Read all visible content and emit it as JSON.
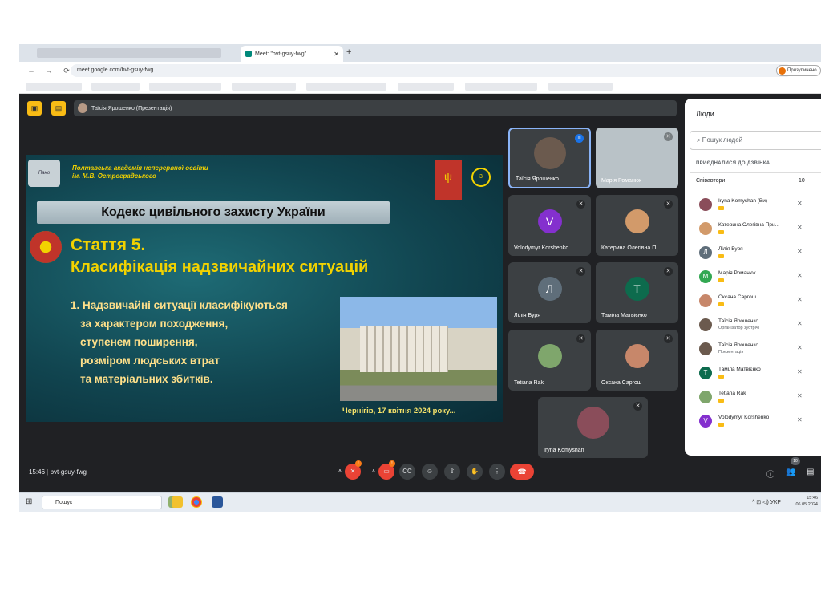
{
  "browser": {
    "tab_title": "Meet: \"bvt-gsuy-fwg\"",
    "tab_close": "✕",
    "new_tab": "+",
    "url": "meet.google.com/bvt-gsuy-fwg",
    "profile_label": "Призупинено",
    "nav": {
      "back": "←",
      "forward": "→",
      "reload": "⟳"
    }
  },
  "meeting": {
    "presenter_label": "Таїсія Ярошенко (Презентація)",
    "time": "15:46",
    "code": "bvt-gsuy-fwg",
    "people_count": "10"
  },
  "slide": {
    "academy_line1": "Полтавська академія неперервної освіти",
    "academy_line2": "ім. М.В. Остроградського",
    "logo_text": "Пано",
    "page_number": "3",
    "code_title": "Кодекс цивільного захисту України",
    "article": "Стаття 5.",
    "article_title": "Класифікація надзвичайних ситуацій",
    "item_lines": [
      "1. Надзвичайні ситуації класифікуються",
      "за характером походження,",
      "ступенем поширення,",
      "розміром людських втрат",
      "та матеріальних збитків."
    ],
    "caption": "Чернігів, 17 квітня 2024 року..."
  },
  "tiles": [
    {
      "name": "Таїсія Ярошенко",
      "initial": "",
      "color": "#6b5a4e"
    },
    {
      "name": "Марія Романюк",
      "initial": "",
      "color": "#9aa1a6"
    },
    {
      "name": "Volodymyr Korshenko",
      "initial": "V",
      "color": "#8430ce"
    },
    {
      "name": "Катерина Олегівна П...",
      "initial": "",
      "color": "#d29a6a"
    },
    {
      "name": "Лілія Буря",
      "initial": "Л",
      "color": "#5f6e7a"
    },
    {
      "name": "Таміла Матвієнко",
      "initial": "Т",
      "color": "#0d6b4d"
    },
    {
      "name": "Tetiana Rak",
      "initial": "",
      "color": "#7fa66c"
    },
    {
      "name": "Оксана Саргош",
      "initial": "",
      "color": "#c7876a"
    },
    {
      "name": "Iryna Komyshan",
      "initial": "",
      "color": "#8a4d5a"
    }
  ],
  "panel": {
    "title": "Люди",
    "search_placeholder": "Пошук людей",
    "section": "ПРИЄДНАЛИСЯ ДО ДЗВІНКА",
    "collab_label": "Співавтори",
    "collab_count": "10",
    "people": [
      {
        "name": "Iryna Komyshan (Ви)",
        "sub": "",
        "initial": "",
        "color": "#8a4d5a"
      },
      {
        "name": "Катерина Олегівна При...",
        "sub": "",
        "initial": "",
        "color": "#d29a6a"
      },
      {
        "name": "Лілія Буря",
        "sub": "",
        "initial": "Л",
        "color": "#5f6e7a"
      },
      {
        "name": "Марія Романюк",
        "sub": "",
        "initial": "М",
        "color": "#33a852"
      },
      {
        "name": "Оксана Саргош",
        "sub": "",
        "initial": "",
        "color": "#c7876a"
      },
      {
        "name": "Таїсія Ярошенко",
        "sub": "Організатор зустрічі",
        "initial": "",
        "color": "#6b5a4e"
      },
      {
        "name": "Таїсія Ярошенко",
        "sub": "Презентація",
        "initial": "",
        "color": "#6b5a4e"
      },
      {
        "name": "Таміла Матвієнко",
        "sub": "",
        "initial": "Т",
        "color": "#0d6b4d"
      },
      {
        "name": "Tetiana Rak",
        "sub": "",
        "initial": "",
        "color": "#7fa66c"
      },
      {
        "name": "Volodymyr Korshenko",
        "sub": "",
        "initial": "V",
        "color": "#8430ce"
      }
    ]
  },
  "taskbar": {
    "search": "Пошук",
    "lang": "УКР",
    "time": "15:46",
    "date": "06.05.2024"
  }
}
